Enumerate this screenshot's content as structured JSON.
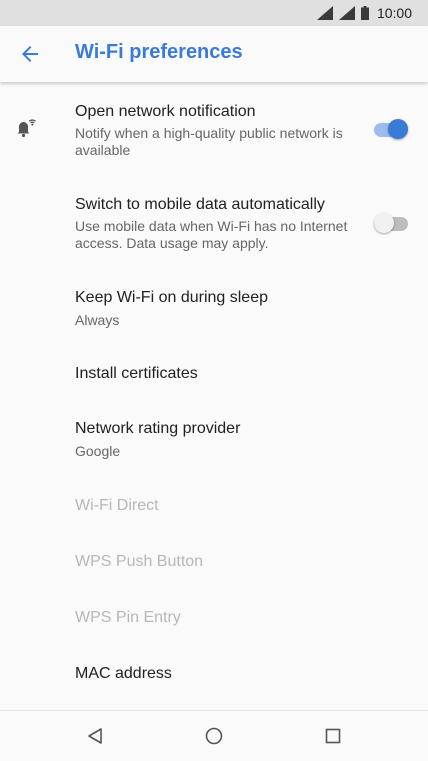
{
  "status_bar": {
    "time": "10:00",
    "icons": [
      "wifi-signal-icon",
      "cell-signal-icon",
      "battery-icon"
    ]
  },
  "header": {
    "back_icon": "back-arrow-icon",
    "title": "Wi-Fi preferences",
    "accent_color": "#3b7bd8"
  },
  "preferences": [
    {
      "title": "Open network notification",
      "summary": "Notify when a high-quality public network is available",
      "icon": "notification-bell-wifi-icon",
      "toggle": true,
      "enabled": true
    },
    {
      "title": "Switch to mobile data automatically",
      "summary": "Use mobile data when Wi-Fi has no Internet access. Data usage may apply.",
      "toggle": false,
      "enabled": true
    },
    {
      "title": "Keep Wi-Fi on during sleep",
      "summary": "Always",
      "enabled": true
    },
    {
      "title": "Install certificates",
      "enabled": true
    },
    {
      "title": "Network rating provider",
      "summary": "Google",
      "enabled": true
    },
    {
      "title": "Wi-Fi Direct",
      "enabled": false
    },
    {
      "title": "WPS Push Button",
      "enabled": false
    },
    {
      "title": "WPS Pin Entry",
      "enabled": false
    },
    {
      "title": "MAC address",
      "enabled": true
    }
  ],
  "nav_bar": {
    "icons": [
      "back-triangle-icon",
      "home-circle-icon",
      "recents-square-icon"
    ]
  },
  "colors": {
    "toggle_on_thumb": "#3b7bd8",
    "toggle_on_track": "#9dbcec",
    "toggle_off_thumb": "#f1f1f1",
    "toggle_off_track": "#bdbdbd",
    "disabled_text": "#b7b7b7"
  }
}
